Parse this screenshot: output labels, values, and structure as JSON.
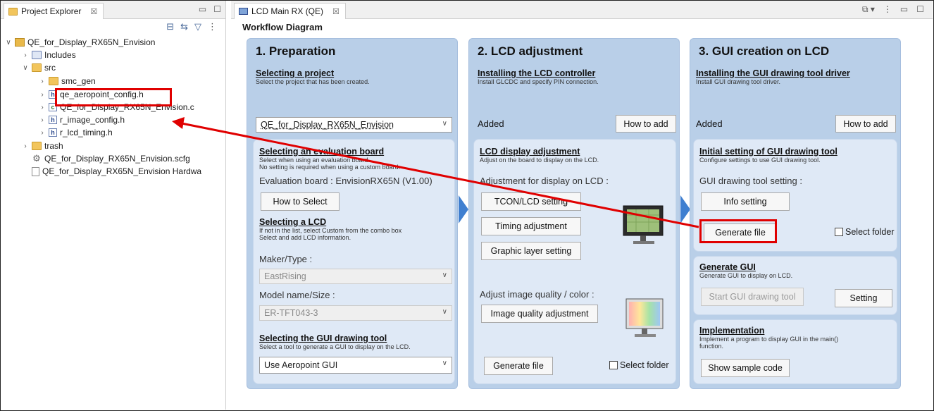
{
  "explorer": {
    "tab_label": "Project Explorer",
    "tab_close": "☒",
    "tree": [
      {
        "label": "QE_for_Display_RX65N_Envision"
      },
      {
        "label": "Includes"
      },
      {
        "label": "src"
      },
      {
        "label": "smc_gen"
      },
      {
        "label": "qe_aeropoint_config.h"
      },
      {
        "label": "QE_for_Display_RX65N_Envision.c"
      },
      {
        "label": "r_image_config.h"
      },
      {
        "label": "r_lcd_timing.h"
      },
      {
        "label": "trash"
      },
      {
        "label": "QE_for_Display_RX65N_Envision.scfg"
      },
      {
        "label": "QE_for_Display_RX65N_Envision Hardwa"
      }
    ]
  },
  "editor": {
    "tab_label": "LCD Main RX (QE)",
    "tab_close": "☒",
    "workflow_title": "Workflow Diagram"
  },
  "col1": {
    "title": "1. Preparation",
    "s1_heading": "Selecting a project",
    "s1_desc": "Select the project that has been created.",
    "project_value": "QE_for_Display_RX65N_Envision",
    "s2_heading": "Selecting an evaluation board",
    "s2_desc1": "Select when using an evaluation board.",
    "s2_desc2": "No setting is required when using a custom board.",
    "board_label": "Evaluation board : EnvisionRX65N (V1.00)",
    "how_to_select": "How to Select",
    "s3_heading": "Selecting a LCD",
    "s3_desc1": "If not in the list, select Custom from the combo box",
    "s3_desc2": "Select and add LCD information.",
    "maker_label": "Maker/Type :",
    "maker_value": "EastRising",
    "model_label": "Model name/Size :",
    "model_value": "ER-TFT043-3",
    "s4_heading": "Selecting the GUI drawing tool",
    "s4_desc": "Select a tool to generate a GUI to display on the LCD.",
    "gui_tool_value": "Use Aeropoint GUI"
  },
  "col2": {
    "title": "2. LCD adjustment",
    "s1_heading": "Installing the LCD controller",
    "s1_desc": "Install GLCDC and specify PIN connection.",
    "added": "Added",
    "how_to_add": "How to add",
    "s2_heading": "LCD display adjustment",
    "s2_desc": "Adjust on the board to display on the LCD.",
    "adjust_label": "Adjustment for display on LCD :",
    "tcon_btn": "TCON/LCD setting",
    "timing_btn": "Timing adjustment",
    "graphic_btn": "Graphic layer setting",
    "quality_label": "Adjust image quality / color :",
    "quality_btn": "Image quality adjustment",
    "generate_btn": "Generate file",
    "select_folder": "Select folder"
  },
  "col3": {
    "title": "3. GUI creation on LCD",
    "s1_heading": "Installing the GUI drawing tool driver",
    "s1_desc": "Install GUI drawing tool driver.",
    "added": "Added",
    "how_to_add": "How to add",
    "s2_heading": "Initial setting of GUI drawing tool",
    "s2_desc": "Configure settings to use GUI drawing tool.",
    "setting_label": "GUI drawing tool setting :",
    "info_btn": "Info setting",
    "generate_btn": "Generate file",
    "select_folder": "Select folder",
    "s3_heading": "Generate GUI",
    "s3_desc": "Generate GUI to display on LCD.",
    "start_btn": "Start GUI drawing tool",
    "setting_btn": "Setting",
    "s4_heading": "Implementation",
    "s4_desc1": "Implement a program to display GUI in the main()",
    "s4_desc2": "function.",
    "sample_btn": "Show sample code"
  },
  "colors": {
    "highlight": "#e00000",
    "column_bg": "#b9cfe8",
    "chevron": "#3f7fd0"
  }
}
